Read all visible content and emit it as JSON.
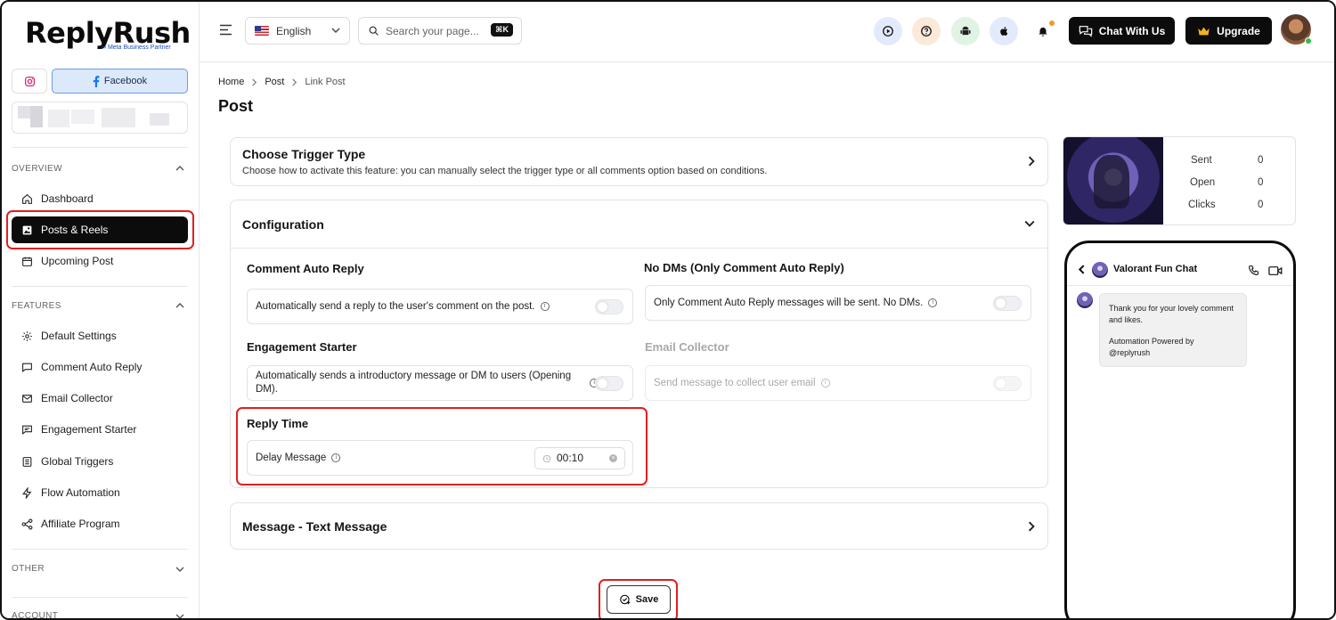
{
  "brand": {
    "name": "ReplyRush",
    "badge": "Meta Business Partner"
  },
  "accounts": {
    "instagram_label": "",
    "facebook_label": "Facebook"
  },
  "sidebar": {
    "sections": [
      {
        "title": "OVERVIEW"
      },
      {
        "title": "FEATURES"
      },
      {
        "title": "OTHER"
      },
      {
        "title": "ACCOUNT"
      }
    ],
    "overview_items": [
      {
        "label": "Dashboard",
        "icon": "home-icon"
      },
      {
        "label": "Posts & Reels",
        "icon": "image-icon",
        "active": true
      },
      {
        "label": "Upcoming Post",
        "icon": "calendar-icon"
      }
    ],
    "feature_items": [
      {
        "label": "Default Settings",
        "icon": "gear-icon"
      },
      {
        "label": "Comment Auto Reply",
        "icon": "comment-icon"
      },
      {
        "label": "Email Collector",
        "icon": "mail-icon"
      },
      {
        "label": "Engagement Starter",
        "icon": "chat-icon"
      },
      {
        "label": "Global Triggers",
        "icon": "list-icon"
      },
      {
        "label": "Flow Automation",
        "icon": "bolt-icon"
      },
      {
        "label": "Affiliate Program",
        "icon": "share-icon"
      }
    ]
  },
  "header": {
    "language": "English",
    "search_placeholder": "Search your page...",
    "search_shortcut": "⌘K",
    "chat_button": "Chat With Us",
    "upgrade_button": "Upgrade"
  },
  "breadcrumb": [
    "Home",
    "Post",
    "Link Post"
  ],
  "page_title": "Post",
  "trigger": {
    "title": "Choose Trigger Type",
    "subtitle": "Choose how to activate this feature: you can manually select the trigger type or all comments option based on conditions."
  },
  "configuration": {
    "title": "Configuration",
    "comment_auto_reply": {
      "label": "Comment Auto Reply",
      "text": "Automatically send a reply to the user's comment on the post.",
      "enabled": false
    },
    "no_dms": {
      "label": "No DMs (Only Comment Auto Reply)",
      "text": "Only Comment Auto Reply messages will be sent. No DMs.",
      "enabled": false
    },
    "engagement_starter": {
      "label": "Engagement Starter",
      "text": "Automatically sends a introductory message or DM to users (Opening DM).",
      "enabled": false
    },
    "email_collector": {
      "label": "Email Collector",
      "text": "Send message to collect user email",
      "enabled": false
    },
    "reply_time": {
      "label": "Reply Time",
      "delay_label": "Delay Message",
      "value": "00:10"
    }
  },
  "message": {
    "title": "Message - Text Message"
  },
  "save_label": "Save",
  "stats": {
    "rows": [
      {
        "label": "Sent",
        "value": "0"
      },
      {
        "label": "Open",
        "value": "0"
      },
      {
        "label": "Clicks",
        "value": "0"
      }
    ]
  },
  "preview": {
    "chat_name": "Valorant Fun Chat",
    "message_line1": "Thank you for your lovely comment and likes.",
    "message_line2": "Automation Powered by @replyrush"
  },
  "colors": {
    "accent": "#0c0c0c",
    "highlight": "#e02020",
    "facebook_tab": "#dbe9fb",
    "upgrade_icon": "#f2b21b"
  }
}
